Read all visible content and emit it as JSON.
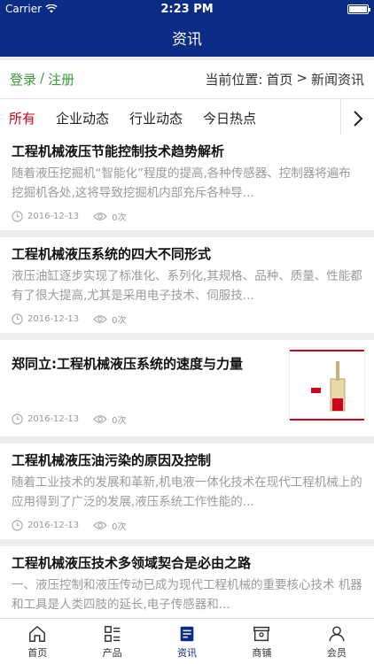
{
  "status": {
    "carrier": "Carrier",
    "time": "2:23 PM"
  },
  "nav": {
    "title": "资讯"
  },
  "auth": {
    "login": "登录",
    "sep": "/",
    "register": "注册"
  },
  "breadcrumb": {
    "label": "当前位置:",
    "home": "首页",
    "sep": ">",
    "current": "新闻资讯"
  },
  "tabs": [
    "所有",
    "企业动态",
    "行业动态",
    "今日热点"
  ],
  "articles": [
    {
      "title": "工程机械液压节能控制技术趋势解析",
      "summary": "随着液压挖掘机“智能化”程度的提高,各种传感器、控制器将遍布挖掘机各处,这将导致挖掘机内部充斥各种导...",
      "date": "2016-12-13",
      "views": "0次"
    },
    {
      "title": "工程机械液压系统的四大不同形式",
      "summary": "液压油缸逐步实现了标准化、系列化,其规格、品种、质量、性能都有了很大提高,尤其是采用电子技术、伺服技...",
      "date": "2016-12-13",
      "views": "0次"
    },
    {
      "title": "郑同立:工程机械液压系统的速度与力量",
      "summary": "",
      "date": "2016-12-13",
      "views": "0次"
    },
    {
      "title": "工程机械液压油污染的原因及控制",
      "summary": "随着工业技术的发展和革新,机电液一体化技术在现代工程机械上的应用得到了广泛的发展,液压系统工作性能的...",
      "date": "2016-12-13",
      "views": "0次"
    },
    {
      "title": "工程机械液压技术多领域契合是必由之路",
      "summary": "一、液压控制和液压传动已成为现代工程机械的重要核心技术 机器和工具是人类四肢的延长,电子传感器和...",
      "date": "",
      "views": ""
    }
  ],
  "tabbar": [
    {
      "label": "首页",
      "icon": "home-icon"
    },
    {
      "label": "产品",
      "icon": "grid-list-icon"
    },
    {
      "label": "资讯",
      "icon": "news-icon"
    },
    {
      "label": "商铺",
      "icon": "shop-icon"
    },
    {
      "label": "会员",
      "icon": "user-icon"
    }
  ],
  "colors": {
    "brand": "#0b2c84",
    "active_tab": "#d0021b",
    "login": "#3a9a3a"
  }
}
